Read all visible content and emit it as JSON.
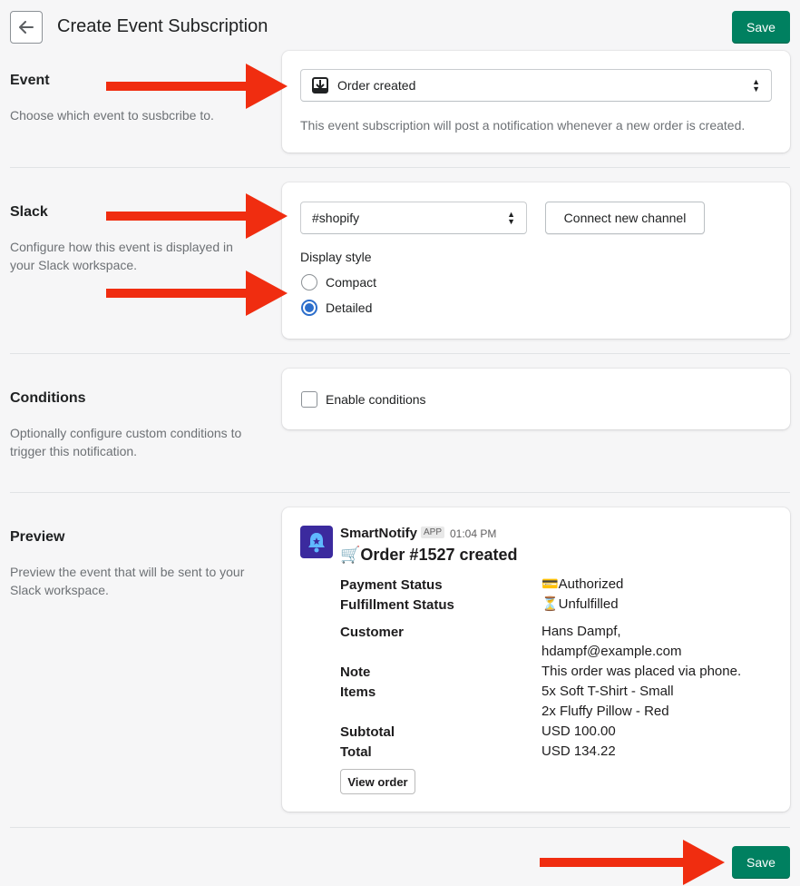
{
  "header": {
    "title": "Create Event Subscription",
    "save_label": "Save"
  },
  "event": {
    "title": "Event",
    "description": "Choose which event to susbcribe to.",
    "selected": "Order created",
    "helper": "This event subscription will post a notification whenever a new order is created."
  },
  "slack": {
    "title": "Slack",
    "description": "Configure how this event is displayed in your Slack workspace.",
    "channel": "#shopify",
    "connect_label": "Connect new channel",
    "display_style_label": "Display style",
    "options": [
      {
        "label": "Compact",
        "checked": false
      },
      {
        "label": "Detailed",
        "checked": true
      }
    ]
  },
  "conditions": {
    "title": "Conditions",
    "description": "Optionally configure custom conditions to trigger this notification.",
    "checkbox_label": "Enable conditions"
  },
  "preview": {
    "title": "Preview",
    "description": "Preview the event that will be sent to your Slack workspace.",
    "app_name": "SmartNotify",
    "app_badge": "APP",
    "time": "01:04 PM",
    "heading": "🛒Order #1527 created",
    "fields": [
      {
        "key": "Payment Status",
        "value": "💳Authorized"
      },
      {
        "key": "Fulfillment Status",
        "value": "⏳Unfulfilled"
      },
      {
        "key": "Customer",
        "value": "Hans Dampf,",
        "value2": "hdampf@example.com"
      },
      {
        "key": "Note",
        "value": "This order was placed via phone."
      },
      {
        "key": "Items",
        "value": "5x Soft T-Shirt - Small",
        "value2": "2x Fluffy Pillow - Red"
      },
      {
        "key": "Subtotal",
        "value": "USD 100.00"
      },
      {
        "key": "Total",
        "value": "USD 134.22"
      }
    ],
    "view_order_label": "View order"
  },
  "colors": {
    "primary": "#008060",
    "arrow": "#f02d10",
    "radio_selected": "#2c6ecb"
  }
}
